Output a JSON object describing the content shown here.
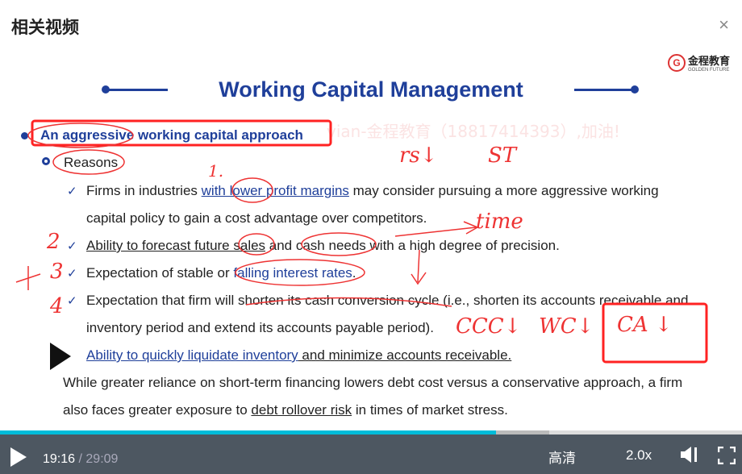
{
  "header": {
    "title": "相关视频",
    "close": "×"
  },
  "slide": {
    "logo": {
      "name": "金程教育",
      "sub": "GOLDEN FUTURE"
    },
    "title": "Working Capital Management",
    "watermark": "vian-金程教育（18817414393）,加油!",
    "heading": "An aggressive working capital approach",
    "sub": "Reasons",
    "items": [
      {
        "a": "Firms in industries ",
        "b": "with lower profit margins",
        "c": " may consider pursuing a more aggressive working",
        "d": "capital policy to gain a cost advantage over competitors."
      },
      {
        "a": "Ability to forecast future sales",
        "c": " and cash needs with a high degree of precision."
      },
      {
        "a": "Expectation of stable or ",
        "b": "falling interest rates",
        "c": "."
      },
      {
        "a": "Expectation that firm will shorten its cash conversion cycle (i.e., shorten its accounts receivable and",
        "d": "inventory period and extend its accounts payable period)."
      },
      {
        "b": "Ability to quickly liquidate inventory",
        "c": " and minimize accounts receivable."
      }
    ],
    "para1": "While greater reliance on short-term financing lowers debt cost versus a conservative approach, a firm",
    "para2a": "also faces greater exposure to ",
    "para2b": "debt rollover risk",
    "para2c": " in times of market stress.",
    "handwriting": {
      "rs": "rs↓",
      "st": "ST",
      "time": "time",
      "one": "1.",
      "two": "2",
      "three": "3",
      "four": "4",
      "ccc": "CCC↓",
      "wc": "WC↓",
      "ca": "CA ↓"
    }
  },
  "player": {
    "current": "19:16",
    "duration": "29:09",
    "progress": 0.668,
    "buffered": 0.74,
    "quality": "高清",
    "speed": "2.0x"
  }
}
